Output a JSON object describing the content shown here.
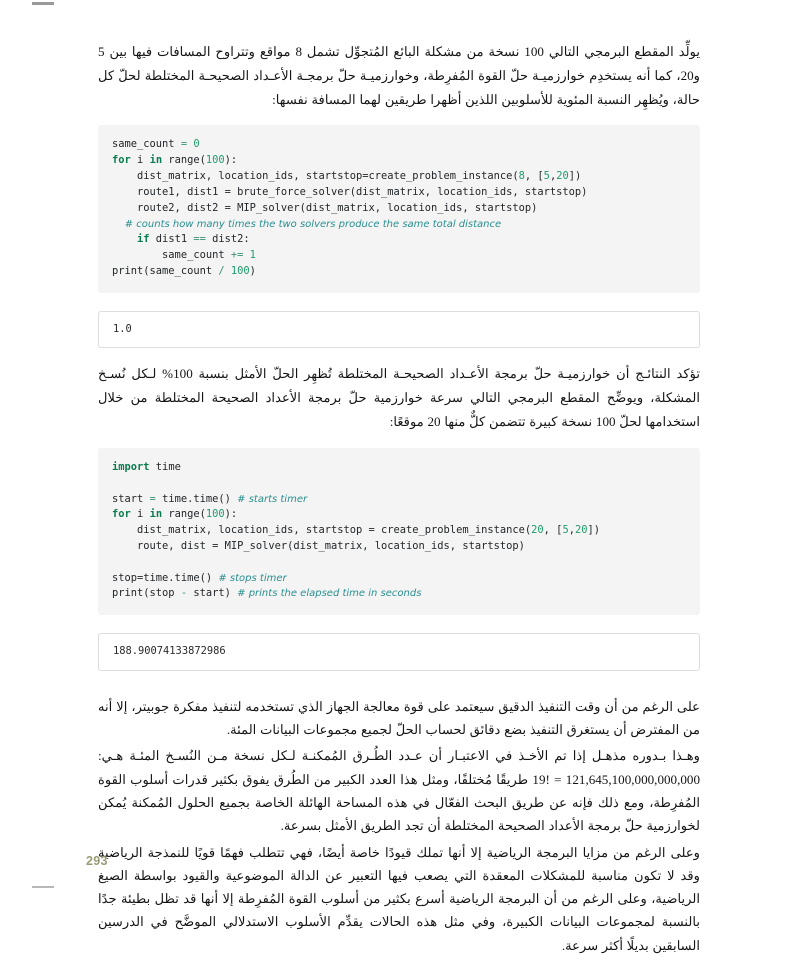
{
  "page": {
    "number": "293",
    "language": "ar",
    "direction": "rtl"
  },
  "paragraphs": {
    "intro": "يولِّد المقطع البرمجي التالي 100 نسخة من مشكلة البائع المُتجوِّل تشمل 8 مواقع وتتراوح المسافات فيها بين 5 و20، كما أنه يستخدِم خوارزميـة حلّ القوة المُفرِطة، وخوارزميـة حلّ برمجـة الأعـداد الصحيحـة المختلطة لحلّ كل حالة، ويُظهِر النسبة المئوية للأسلوبين اللذين أظهرا طريقين لهما المسافة نفسها:",
    "middle": "تؤكد النتائـج أن خوارزميـة حلّ برمجة الأعـداد الصحيحـة المختلطة تُظهِر الحلّ الأمثل بنسبة 100% لـكل نُسـخ المشكلة، ويوضِّح المقطع البرمجي التالي سرعة خوارزمية حلّ برمجة الأعداد الصحيحة المختلطة من خلال استخدامها لحلّ 100 نسخة كبيرة تتضمن كلٌّ منها 20 موقعًا:",
    "closing_1": "على الرغم من أن وقت التنفيذ الدقيق سيعتمد على قوة معالجة الجهاز الذي تستخدمه لتنفيذ مفكرة جوبيتر، إلا أنه من المفترض أن يستغرق التنفيذ بضع دقائق لحساب الحلّ لجميع مجموعات البيانات المئة.",
    "closing_2": "وهـذا بـدوره مذهـل إذا تم الأخـذ في الاعتبـار أن عـدد الطُـرق المُمكنـة لـكل نسخة مـن النُسـخ المئـة هـي: 121,645,100,000,000,000 = !19 طريقًا مُختلفًا، ومثل هذا العدد الكبير من الطُرق يفوق بكثير قدرات أسلوب القوة المُفرِطة، ومع ذلك فإنه عن طريق البحث الفعّال في هذه المساحة الهائلة الخاصة بجميع الحلول المُمكنة يُمكن لخوارزمية حلّ برمجة الأعداد الصحيحة المختلطة أن تجد الطريق الأمثل بسرعة.",
    "closing_3": "وعلى الرغم من مزايا البرمجة الرياضية إلا أنها تملك قيودًا خاصة أيضًا، فهي تتطلب فهمًا قويًا للنمذجة الرياضية وقد لا تكون مناسبة للمشكلات المعقدة التي يصعب فيها التعبير عن الدالة الموضوعية والقيود بواسطة الصيغ الرياضية، وعلى الرغم من أن البرمجة الرياضية أسرع بكثير من أسلوب القوة المُفرِطة إلا أنها قد تظل بطيئة جدًا بالنسبة لمجموعات البيانات الكبيرة، وفي مثل هذه الحالات يقدِّم الأسلوب الاستدلالي الموضَّح في الدرسين السابقين بديلًا أكثر سرعة."
  },
  "code_blocks": [
    {
      "id": "code-same-count",
      "language": "python",
      "lines": [
        [
          {
            "t": "plain",
            "s": "same_count "
          },
          {
            "t": "op",
            "s": "="
          },
          {
            "t": "num",
            "s": " 0"
          }
        ],
        [
          {
            "t": "kw",
            "s": "for"
          },
          {
            "t": "plain",
            "s": " i "
          },
          {
            "t": "kw",
            "s": "in"
          },
          {
            "t": "plain",
            "s": " range("
          },
          {
            "t": "num",
            "s": "100"
          },
          {
            "t": "plain",
            "s": "):"
          }
        ],
        [
          {
            "t": "plain",
            "s": "    dist_matrix, location_ids, startstop=create_problem_instance("
          },
          {
            "t": "num",
            "s": "8"
          },
          {
            "t": "plain",
            "s": ", ["
          },
          {
            "t": "num",
            "s": "5"
          },
          {
            "t": "plain",
            "s": ","
          },
          {
            "t": "num",
            "s": "20"
          },
          {
            "t": "plain",
            "s": "])"
          }
        ],
        [
          {
            "t": "plain",
            "s": "    route1, dist1 = brute_force_solver(dist_matrix, location_ids, startstop)"
          }
        ],
        [
          {
            "t": "plain",
            "s": "    route2, dist2 = MIP_solver(dist_matrix, location_ids, startstop)"
          }
        ],
        [
          {
            "t": "com",
            "s": "    # counts how many times the two solvers produce the same total distance"
          }
        ],
        [
          {
            "t": "plain",
            "s": "    "
          },
          {
            "t": "kw",
            "s": "if"
          },
          {
            "t": "plain",
            "s": " dist1 "
          },
          {
            "t": "op",
            "s": "=="
          },
          {
            "t": "plain",
            "s": " dist2:"
          }
        ],
        [
          {
            "t": "plain",
            "s": "        same_count "
          },
          {
            "t": "op",
            "s": "+="
          },
          {
            "t": "num",
            "s": " 1"
          }
        ],
        [
          {
            "t": "plain",
            "s": "print(same_count "
          },
          {
            "t": "op",
            "s": "/"
          },
          {
            "t": "num",
            "s": " 100"
          },
          {
            "t": "plain",
            "s": ")"
          }
        ]
      ]
    },
    {
      "id": "code-timer",
      "language": "python",
      "lines": [
        [
          {
            "t": "kw",
            "s": "import"
          },
          {
            "t": "plain",
            "s": " time"
          }
        ],
        [
          {
            "t": "plain",
            "s": " "
          }
        ],
        [
          {
            "t": "plain",
            "s": "start "
          },
          {
            "t": "op",
            "s": "="
          },
          {
            "t": "plain",
            "s": " time.time() "
          },
          {
            "t": "com",
            "s": "# starts timer"
          }
        ],
        [
          {
            "t": "kw",
            "s": "for"
          },
          {
            "t": "plain",
            "s": " i "
          },
          {
            "t": "kw",
            "s": "in"
          },
          {
            "t": "plain",
            "s": " range("
          },
          {
            "t": "num",
            "s": "100"
          },
          {
            "t": "plain",
            "s": "):"
          }
        ],
        [
          {
            "t": "plain",
            "s": "    dist_matrix, location_ids, startstop = create_problem_instance("
          },
          {
            "t": "num",
            "s": "20"
          },
          {
            "t": "plain",
            "s": ", ["
          },
          {
            "t": "num",
            "s": "5"
          },
          {
            "t": "plain",
            "s": ","
          },
          {
            "t": "num",
            "s": "20"
          },
          {
            "t": "plain",
            "s": "])"
          }
        ],
        [
          {
            "t": "plain",
            "s": "    route, dist = MIP_solver(dist_matrix, location_ids, startstop)"
          }
        ],
        [
          {
            "t": "plain",
            "s": " "
          }
        ],
        [
          {
            "t": "plain",
            "s": "stop=time.time() "
          },
          {
            "t": "com",
            "s": "# stops timer"
          }
        ],
        [
          {
            "t": "plain",
            "s": "print(stop "
          },
          {
            "t": "op",
            "s": "-"
          },
          {
            "t": "plain",
            "s": " start) "
          },
          {
            "t": "com",
            "s": "# prints the elapsed time in seconds"
          }
        ]
      ]
    }
  ],
  "outputs": {
    "first": "1.0",
    "second": "188.90074133872986"
  },
  "colors": {
    "code_background": "#f4f4f4",
    "keyword": "#0a7d4f",
    "number": "#1f9c6b",
    "comment": "#2a8f8f",
    "page_number": "#9a9b76",
    "output_border": "#dddddd"
  }
}
